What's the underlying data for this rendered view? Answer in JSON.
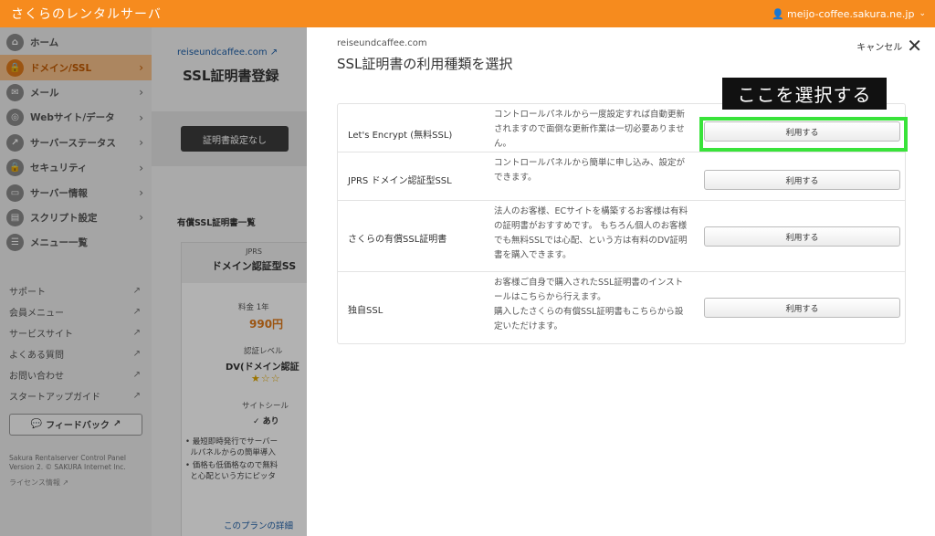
{
  "topbar": {
    "brand": "さくらのレンタルサーバ",
    "account": "meijo-coffee.sakura.ne.jp"
  },
  "sidebar": {
    "nav": [
      {
        "label": "ホーム",
        "icon": "home-icon",
        "glyph": "⌂",
        "active": false,
        "arrow": false
      },
      {
        "label": "ドメイン/SSL",
        "icon": "ssl-icon",
        "glyph": "🔒",
        "active": true,
        "arrow": true
      },
      {
        "label": "メール",
        "icon": "mail-icon",
        "glyph": "✉",
        "active": false,
        "arrow": true
      },
      {
        "label": "Webサイト/データ",
        "icon": "globe-icon",
        "glyph": "◎",
        "active": false,
        "arrow": true
      },
      {
        "label": "サーバーステータス",
        "icon": "status-icon",
        "glyph": "↗",
        "active": false,
        "arrow": true
      },
      {
        "label": "セキュリティ",
        "icon": "lock-icon",
        "glyph": "🔒",
        "active": false,
        "arrow": true
      },
      {
        "label": "サーバー情報",
        "icon": "server-icon",
        "glyph": "▭",
        "active": false,
        "arrow": true
      },
      {
        "label": "スクリプト設定",
        "icon": "script-icon",
        "glyph": "▤",
        "active": false,
        "arrow": true
      },
      {
        "label": "メニュー一覧",
        "icon": "menu-list-icon",
        "glyph": "☰",
        "active": false,
        "arrow": false
      }
    ],
    "links": [
      "サポート",
      "会員メニュー",
      "サービスサイト",
      "よくある質問",
      "お問い合わせ",
      "スタートアップガイド"
    ],
    "feedback_label": "フィードバック",
    "copyright_line1": "Sakura Rentalserver Control Panel",
    "copyright_line2": "Version 2. © SAKURA Internet Inc.",
    "license": "ライセンス情報"
  },
  "bg": {
    "domain": "reiseundcaffee.com",
    "title": "SSL証明書登録",
    "button": "証明書設定なし",
    "section": "有償SSL証明書一覧",
    "card_small": "JPRS",
    "card_big": "ドメイン認証型SS",
    "fee_label": "料金 1年",
    "price": "990円",
    "auth_label": "認証レベル",
    "auth_value": "DV(ドメイン認証",
    "stars": "★☆☆",
    "seal_label": "サイトシール",
    "seal_value": "✓ あり",
    "bullet1": "最短即時発行でサーバー",
    "bullet1b": "ルパネルからの簡単導入",
    "bullet2": "価格も低価格なので無料",
    "bullet2b": "と心配という方にピッタ",
    "detail_link": "このプランの詳細"
  },
  "modal": {
    "domain": "reiseundcaffee.com",
    "title": "SSL証明書の利用種類を選択",
    "cancel": "キャンセル",
    "callout": "ここを選択する",
    "options": [
      {
        "name": "Let's Encrypt (無料SSL)",
        "desc": "コントロールパネルから一度設定すれば自動更新されますので面倒な更新作業は一切必要ありません。",
        "button": "利用する"
      },
      {
        "name": "JPRS ドメイン認証型SSL",
        "desc": "コントロールパネルから簡単に申し込み、設定ができます。",
        "button": "利用する"
      },
      {
        "name": "さくらの有償SSL証明書",
        "desc": "法人のお客様、ECサイトを構築するお客様は有料の証明書がおすすめです。 もちろん個人のお客様でも無料SSLでは心配、という方は有料のDV証明書を購入できます。",
        "button": "利用する"
      },
      {
        "name": "独自SSL",
        "desc": "お客様ご自身で購入されたSSL証明書のインストールはこちらから行えます。\n購入したさくらの有償SSL証明書もこちらから設定いただけます。",
        "button": "利用する"
      }
    ]
  },
  "colors": {
    "brand": "#f68b1e",
    "highlight": "#39e33a",
    "active_bg": "#f7c08a"
  }
}
